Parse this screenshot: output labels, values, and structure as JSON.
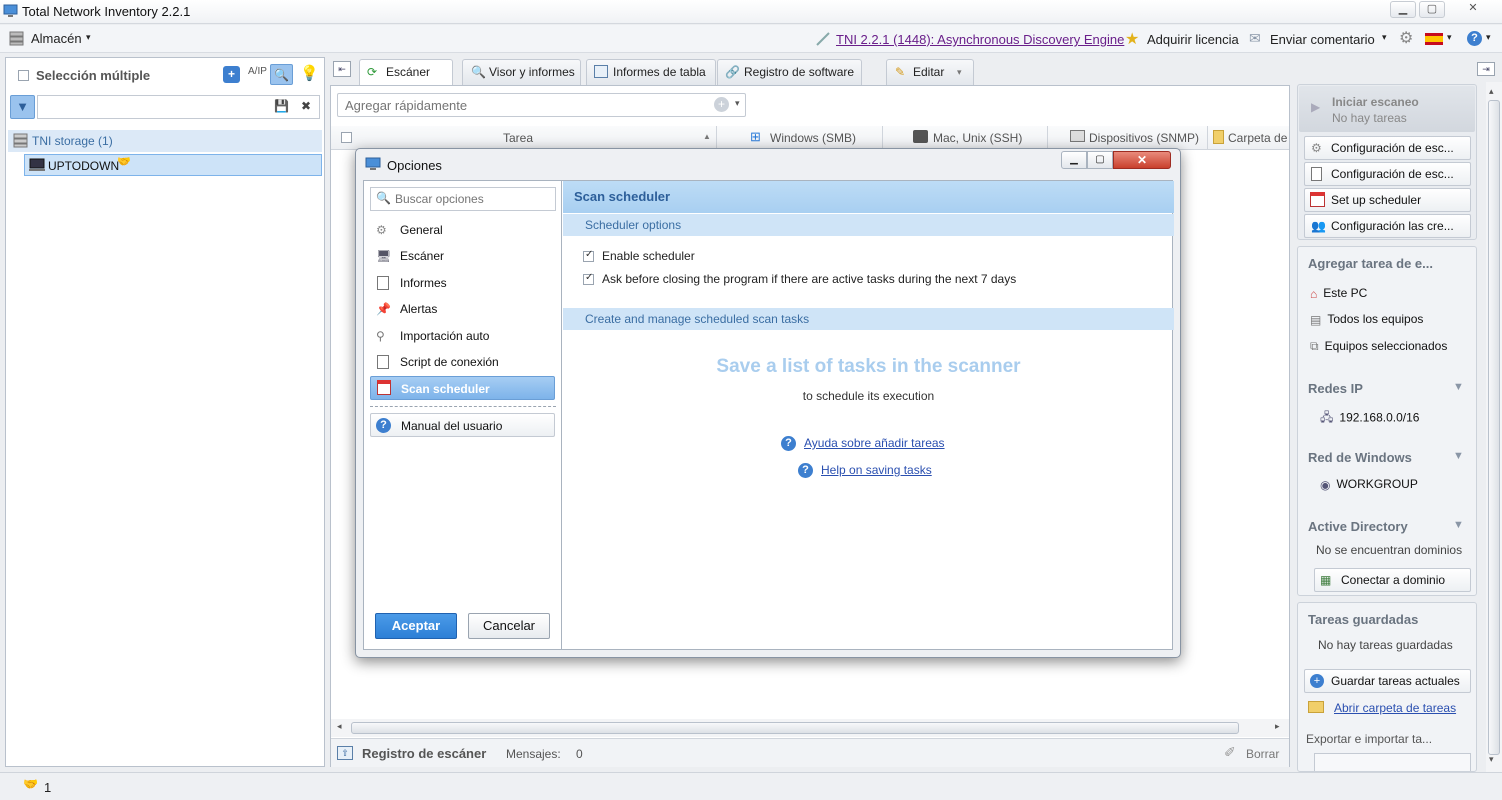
{
  "window": {
    "title": "Total Network Inventory 2.2.1"
  },
  "menubar": {
    "almacen": "Almacén",
    "version_link": "TNI 2.2.1 (1448): Asynchronous Discovery Engine",
    "license": "Adquirir licencia",
    "feedback": "Enviar comentario"
  },
  "left": {
    "multi_select": "Selección múltiple",
    "filter_placeholder": "",
    "storage": "TNI storage (1)",
    "node": "UPTODOWN"
  },
  "tabs": [
    {
      "label": "Escáner"
    },
    {
      "label": "Visor y informes"
    },
    {
      "label": "Informes de tabla"
    },
    {
      "label": "Registro de software"
    },
    {
      "label": "Editar"
    }
  ],
  "center": {
    "quick_add_placeholder": "Agregar rápidamente",
    "columns": [
      "Tarea",
      "Windows (SMB)",
      "Mac, Unix (SSH)",
      "Dispositivos (SNMP)",
      "Carpeta de"
    ],
    "log_title": "Registro de escáner",
    "messages_label": "Mensajes:",
    "messages_count": "0",
    "clear": "Borrar"
  },
  "right": {
    "start_scan": "Iniciar escaneo",
    "no_tasks": "No hay tareas",
    "buttons": [
      "Configuración de esc...",
      "Configuración de esc...",
      "Set up scheduler",
      "Configuración las cre..."
    ],
    "add_task_title": "Agregar tarea de e...",
    "add_task_items": [
      "Este PC",
      "Todos los equipos",
      "Equipos seleccionados"
    ],
    "ip_networks_title": "Redes IP",
    "ip_network": "192.168.0.0/16",
    "windows_net_title": "Red de Windows",
    "workgroup": "WORKGROUP",
    "ad_title": "Active Directory",
    "ad_none": "No se encuentran dominios",
    "ad_connect": "Conectar a dominio",
    "saved_title": "Tareas guardadas",
    "saved_none": "No hay tareas guardadas",
    "save_current": "Guardar tareas actuales",
    "open_folder": "Abrir carpeta de tareas",
    "export_import": "Exportar e importar ta..."
  },
  "dialog": {
    "title": "Opciones",
    "search_placeholder": "Buscar opciones",
    "options": [
      "General",
      "Escáner",
      "Informes",
      "Alertas",
      "Importación auto",
      "Script de conexión",
      "Scan scheduler"
    ],
    "manual": "Manual del usuario",
    "accept": "Aceptar",
    "cancel": "Cancelar",
    "panel_title": "Scan scheduler",
    "scheduler_options": "Scheduler options",
    "enable_scheduler": "Enable scheduler",
    "ask_before_closing": "Ask before closing the program if there are active tasks during the next 7 days",
    "create_manage": "Create and manage scheduled scan tasks",
    "empty_title": "Save a list of tasks in the scanner",
    "empty_sub": "to schedule its execution",
    "help_add": "Ayuda sobre añadir tareas",
    "help_save": "Help on saving tasks"
  },
  "status": {
    "count": "1"
  }
}
